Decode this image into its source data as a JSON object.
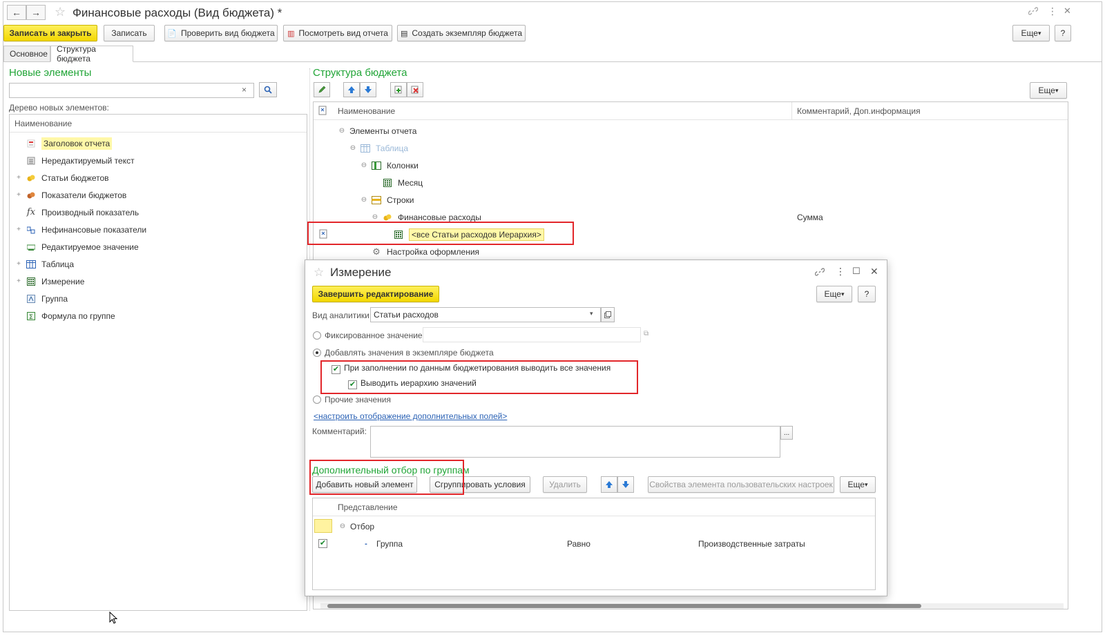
{
  "window": {
    "title": "Финансовые расходы (Вид бюджета) *",
    "nav_back": "←",
    "nav_forward": "→",
    "star": "☆",
    "title_link_icon": "🔗",
    "title_menu_icon": "⋮",
    "title_close_icon": "✕"
  },
  "toolbar": {
    "save_close": "Записать и закрыть",
    "save": "Записать",
    "check": "Проверить вид бюджета",
    "view_report": "Посмотреть вид отчета",
    "create_instance": "Создать экземпляр бюджета",
    "more": "Еще",
    "help": "?"
  },
  "tabs": [
    {
      "label": "Основное"
    },
    {
      "label": "Структура бюджета"
    }
  ],
  "left_panel": {
    "title": "Новые элементы",
    "search_clear": "×",
    "tree_label": "Дерево новых элементов:",
    "column_header": "Наименование",
    "items": [
      {
        "label": "Заголовок отчета",
        "icon": "report-title-icon",
        "expander": ""
      },
      {
        "label": "Нередактируемый текст",
        "icon": "text-icon",
        "expander": ""
      },
      {
        "label": "Статьи бюджетов",
        "icon": "budget-items-icon",
        "expander": "+"
      },
      {
        "label": "Показатели бюджетов",
        "icon": "budget-indicators-icon",
        "expander": "+"
      },
      {
        "label": "Производный показатель",
        "icon": "function-icon",
        "expander": ""
      },
      {
        "label": "Нефинансовые показатели",
        "icon": "nonfinancial-icon",
        "expander": "+"
      },
      {
        "label": "Редактируемое значение",
        "icon": "editable-value-icon",
        "expander": ""
      },
      {
        "label": "Таблица",
        "icon": "table-icon",
        "expander": "+"
      },
      {
        "label": "Измерение",
        "icon": "dimension-icon",
        "expander": "+"
      },
      {
        "label": "Группа",
        "icon": "group-icon",
        "expander": ""
      },
      {
        "label": "Формула по группе",
        "icon": "group-formula-icon",
        "expander": ""
      }
    ]
  },
  "right_panel": {
    "title": "Структура бюджета",
    "more": "Еще",
    "col_name": "Наименование",
    "col_comment": "Комментарий, Доп.информация",
    "rows": [
      {
        "label": "Элементы отчета",
        "expander": "⊖",
        "comment": ""
      },
      {
        "label": "Таблица",
        "expander": "⊖",
        "comment": ""
      },
      {
        "label": "Колонки",
        "expander": "⊖",
        "comment": ""
      },
      {
        "label": "Месяц",
        "expander": "",
        "comment": ""
      },
      {
        "label": "Строки",
        "expander": "⊖",
        "comment": ""
      },
      {
        "label": "Финансовые расходы",
        "expander": "⊖",
        "comment": "Сумма"
      },
      {
        "label": "<все Статьи расходов Иерархия>",
        "expander": "",
        "comment": ""
      },
      {
        "label": "Настройка оформления",
        "expander": "",
        "comment": ""
      }
    ]
  },
  "dialog": {
    "title": "Измерение",
    "finish_editing": "Завершить редактирование",
    "more": "Еще",
    "help": "?",
    "analytics_label": "Вид аналитики:",
    "analytics_value": "Статьи расходов",
    "fixed_value_label": "Фиксированное значение",
    "add_values_label": "Добавлять значения в экземпляре бюджета",
    "fill_all_label": "При заполнении по данным бюджетирования выводить все значения",
    "hierarchy_label": "Выводить иерархию значений",
    "other_values_label": "Прочие значения",
    "configure_link": "<настроить отображение дополнительных полей>",
    "comment_label": "Комментарий:",
    "comment_btn": "...",
    "filter_title": "Дополнительный отбор по группам",
    "add_element": "Добавить новый элемент",
    "group_conditions": "Сгруппировать условия",
    "delete": "Удалить",
    "properties": "Свойства элемента пользовательских настроек",
    "filter_more": "Еще",
    "filter_header": "Представление",
    "filter_root": "Отбор",
    "filter_row": {
      "field": "Группа",
      "condition": "Равно",
      "value": "Производственные затраты"
    },
    "fill_all_checked": true,
    "hierarchy_checked": true
  },
  "colors": {
    "accent_green": "#21a537",
    "primary_yellow": "#f2d700",
    "highlight_red": "#e2262a",
    "link_blue": "#2b62b5"
  }
}
